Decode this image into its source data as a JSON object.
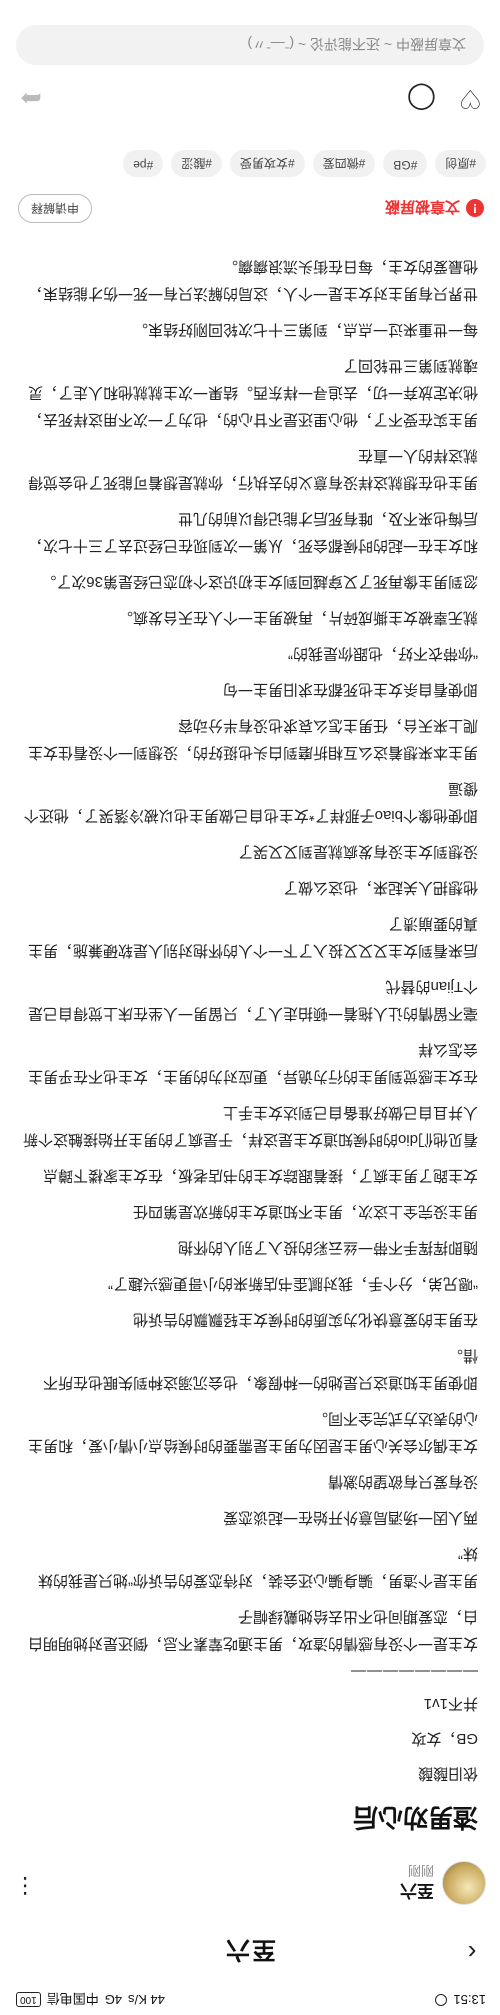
{
  "status_bar": {
    "time": "13:51",
    "battery": "100",
    "carrier": "中国电信",
    "speed": "44 K/s",
    "network": "4G"
  },
  "navbar": {
    "back_icon": "chevron-left-icon",
    "title": "至六"
  },
  "author": {
    "name": "至六",
    "time": "刚刚",
    "more_icon": "more-vertical-icon"
  },
  "article": {
    "title": "渣男劝心后",
    "tags_line": "依旧酸酸",
    "genre_line": "GB，女攻",
    "status_line": "并不1v1",
    "separator": "————————",
    "paragraphs": [
      "女主是一个没有感情的渣攻，男主通吃荤素不忌，倒还是对她明明白白，恋爱期间也不出去给她戴绿帽子",
      "男主是个渣男，骗身骗心还会装，对待恋爱的告诉你“她只是我的妹妹”",
      "两人因一场酒局意外开始在一起谈恋爱",
      "没有爱只有欲望的激情",
      "女主偶尔会关心男主是因为男主是需要的时候给点小情小爱，和男主心的表达方式完全不同。",
      "即使男主知道这只是她的一种假象，也会沉溺这种到失眠也在所不惜。",
      "在男主的爱意快化为实质的时候女主轻飘飘的告诉他",
      "“嗯兄弟，分个手，我对腻歪书店新来的小哥更感兴趣了”",
      "随即挥挥手不带一丝云彩的投入了别人的怀抱",
      "男主没完全上这次，男主不知道女主的新欢是第四任",
      "女主跑了男主疯了，接着跟踪女主的书店老板，在女主家楼下蹲点",
      "看见他们dio的时候知道女主是这样，于是疯了的男主开始接触这个新人并且自己做好准备自己到达女主手上",
      "在女主感觉到男主的行为诡异，更应对为的男主，女主也不在乎男主会怎么样",
      "毫不留情的让人拖着一顿拍走人了，只留男一人坐在床上觉得自己是个Tjian的替代",
      "后来看到女主又又又投入了下一个人的怀抱对别人是软硬兼施，男主真的要崩溃了",
      "他想把人关起来，也这么做了",
      "没想到女主没有发疯就是到又又哭了",
      "即使他像个biao子那样了*女主也自己做男主也以被冷落哭了，他还个傻逼",
      "男主本来想着这么互相折磨到白头也挺好的，没想到一个没看住女主爬上来天台，任男主怎么哀求也没有半分动容",
      "即使看自杀女主也死都在求旧男主一句",
      "“你带衣不好，也跟你是我的”",
      "就无辜被女主撕成碎片，再被男主一个人在天台发疯。",
      "忽到男主像再死了又穿越回到女主初识这个初恋已经是第36次了。",
      "和女主在一起的时候都会死，从第一次到现在已经过去了三十七次，后悔也来不及，唯有死后才能记得以前的几世",
      "男主也在想就这样没有意义的去执行，你就是想着可能死了也会觉得就这样的人一直在",
      "男主实在受不了，他心里还是不甘心的，也为了一次不用这样死去，他决定放弃一切，去追寻一样东西。结果一次主就就他和人走了，灵魂就到第三世轮回了",
      "每一世重来过一点点，到第三十七次轮回刚好结束。",
      "世界只有男主对女主是一个人，这局的解法只有一死一伤才能结束，他最爱的女主，每日在街头流浪瘸瘸。"
    ]
  },
  "hidden_notice": {
    "icon": "alert-icon",
    "label": "文章被屏蔽",
    "appeal": "申请解释"
  },
  "tag_chips": [
    "#原创",
    "#GB",
    "#微四爱",
    "#女攻男受",
    "#酸涩",
    "#pe"
  ],
  "actions": {
    "share_icon": "share-icon",
    "comment_icon": "comment-icon",
    "like_icon": "heart-icon"
  },
  "comment_bar": {
    "placeholder": "文章屏蔽中 ~ 还不能评论 ~ (ˉ—ˉ〃)"
  }
}
